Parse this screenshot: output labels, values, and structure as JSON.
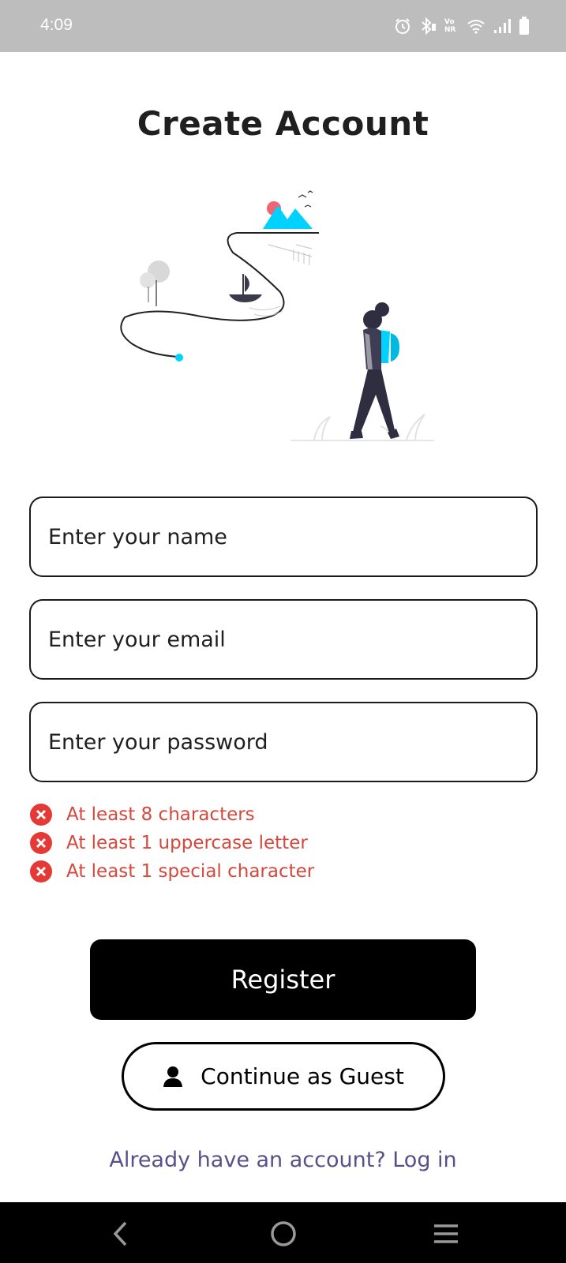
{
  "status_bar": {
    "time": "4:09",
    "icons": [
      "alarm-icon",
      "bluetooth-icon",
      "vonr-icon",
      "wifi-icon",
      "signal-icon",
      "battery-icon"
    ],
    "vonr_text": "Vo NR"
  },
  "page": {
    "title": "Create Account"
  },
  "form": {
    "name_placeholder": "Enter your name",
    "email_placeholder": "Enter your email",
    "password_placeholder": "Enter your password"
  },
  "password_rules": [
    {
      "text": "At least 8 characters",
      "status": "fail"
    },
    {
      "text": "At least 1 uppercase letter",
      "status": "fail"
    },
    {
      "text": "At least 1 special character",
      "status": "fail"
    }
  ],
  "buttons": {
    "register": "Register",
    "guest": "Continue as Guest"
  },
  "login_link": "Already have an account? Log in",
  "nav": {
    "icons": [
      "back-icon",
      "home-icon",
      "recents-icon"
    ]
  },
  "colors": {
    "accent": "#00d2ff",
    "error": "#e53935",
    "link": "#5b4f8a",
    "status_bar_bg": "#bdbdbd"
  }
}
